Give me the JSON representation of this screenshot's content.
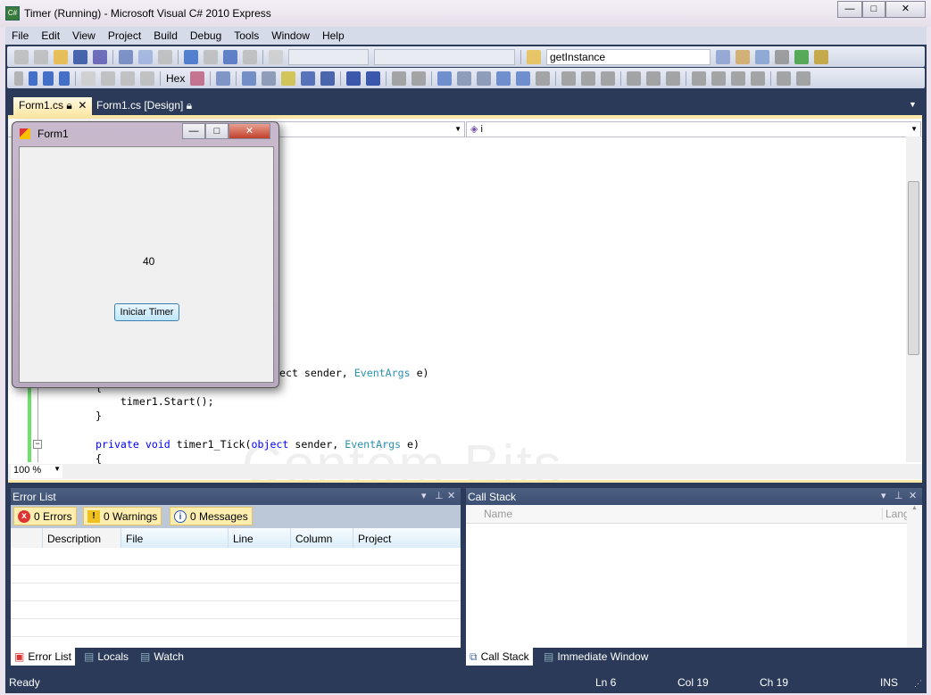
{
  "window": {
    "title": "Timer (Running) - Microsoft Visual C# 2010 Express",
    "app_icon": "C#"
  },
  "menu": [
    "File",
    "Edit",
    "View",
    "Project",
    "Build",
    "Debug",
    "Tools",
    "Window",
    "Help"
  ],
  "toolbar": {
    "find_combo": "getInstance",
    "hex_label": "Hex"
  },
  "tabs": [
    {
      "label": "Form1.cs",
      "active": true
    },
    {
      "label": "Form1.cs [Design]",
      "active": false
    }
  ],
  "editor": {
    "member_combo": "i",
    "zoom": "100 %",
    "watermark": "Contém Bits",
    "lines": [
      {
        "kw": "",
        "rest": "ect sender, ",
        "ty": "EventArgs",
        "tail": " e)"
      },
      {
        "text": "{"
      },
      {
        "text": "    timer1.Start();"
      },
      {
        "text": "}"
      },
      {
        "kw": "private void ",
        "rest": "timer1_Tick(",
        "kw2": "object",
        "rest2": " sender, ",
        "ty": "EventArgs",
        "tail": " e)"
      },
      {
        "text": "{"
      }
    ]
  },
  "form1": {
    "title": "Form1",
    "label_value": "40",
    "button": "Iniciar Timer"
  },
  "error_list": {
    "title": "Error List",
    "errors": "0 Errors",
    "warnings": "0 Warnings",
    "messages": "0 Messages",
    "columns": [
      "Description",
      "File",
      "Line",
      "Column",
      "Project"
    ]
  },
  "call_stack": {
    "title": "Call Stack",
    "columns": [
      "Name",
      "Lang"
    ]
  },
  "bottom_tabs_left": [
    "Error List",
    "Locals",
    "Watch"
  ],
  "bottom_tabs_right": [
    "Call Stack",
    "Immediate Window"
  ],
  "status": {
    "text": "Ready",
    "ln": "Ln 6",
    "col": "Col 19",
    "ch": "Ch 19",
    "mode": "INS"
  },
  "colors": {
    "frame": "#2b3a58",
    "active_tab": "#fde8a8",
    "keyword": "#0000ff",
    "type": "#2b91af"
  }
}
